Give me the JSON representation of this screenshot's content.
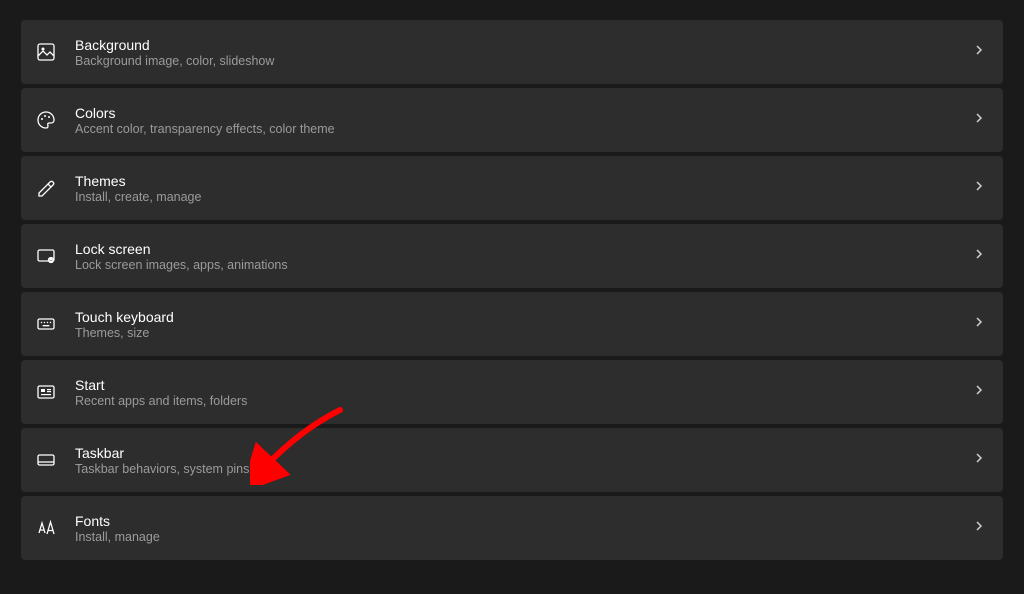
{
  "settings": [
    {
      "icon": "background-icon",
      "title": "Background",
      "desc": "Background image, color, slideshow"
    },
    {
      "icon": "colors-icon",
      "title": "Colors",
      "desc": "Accent color, transparency effects, color theme"
    },
    {
      "icon": "themes-icon",
      "title": "Themes",
      "desc": "Install, create, manage"
    },
    {
      "icon": "lockscreen-icon",
      "title": "Lock screen",
      "desc": "Lock screen images, apps, animations"
    },
    {
      "icon": "touchkeyboard-icon",
      "title": "Touch keyboard",
      "desc": "Themes, size"
    },
    {
      "icon": "start-icon",
      "title": "Start",
      "desc": "Recent apps and items, folders"
    },
    {
      "icon": "taskbar-icon",
      "title": "Taskbar",
      "desc": "Taskbar behaviors, system pins"
    },
    {
      "icon": "fonts-icon",
      "title": "Fonts",
      "desc": "Install, manage"
    }
  ],
  "annotation": {
    "arrow_target": "Taskbar",
    "arrow_color": "#ff0000"
  }
}
